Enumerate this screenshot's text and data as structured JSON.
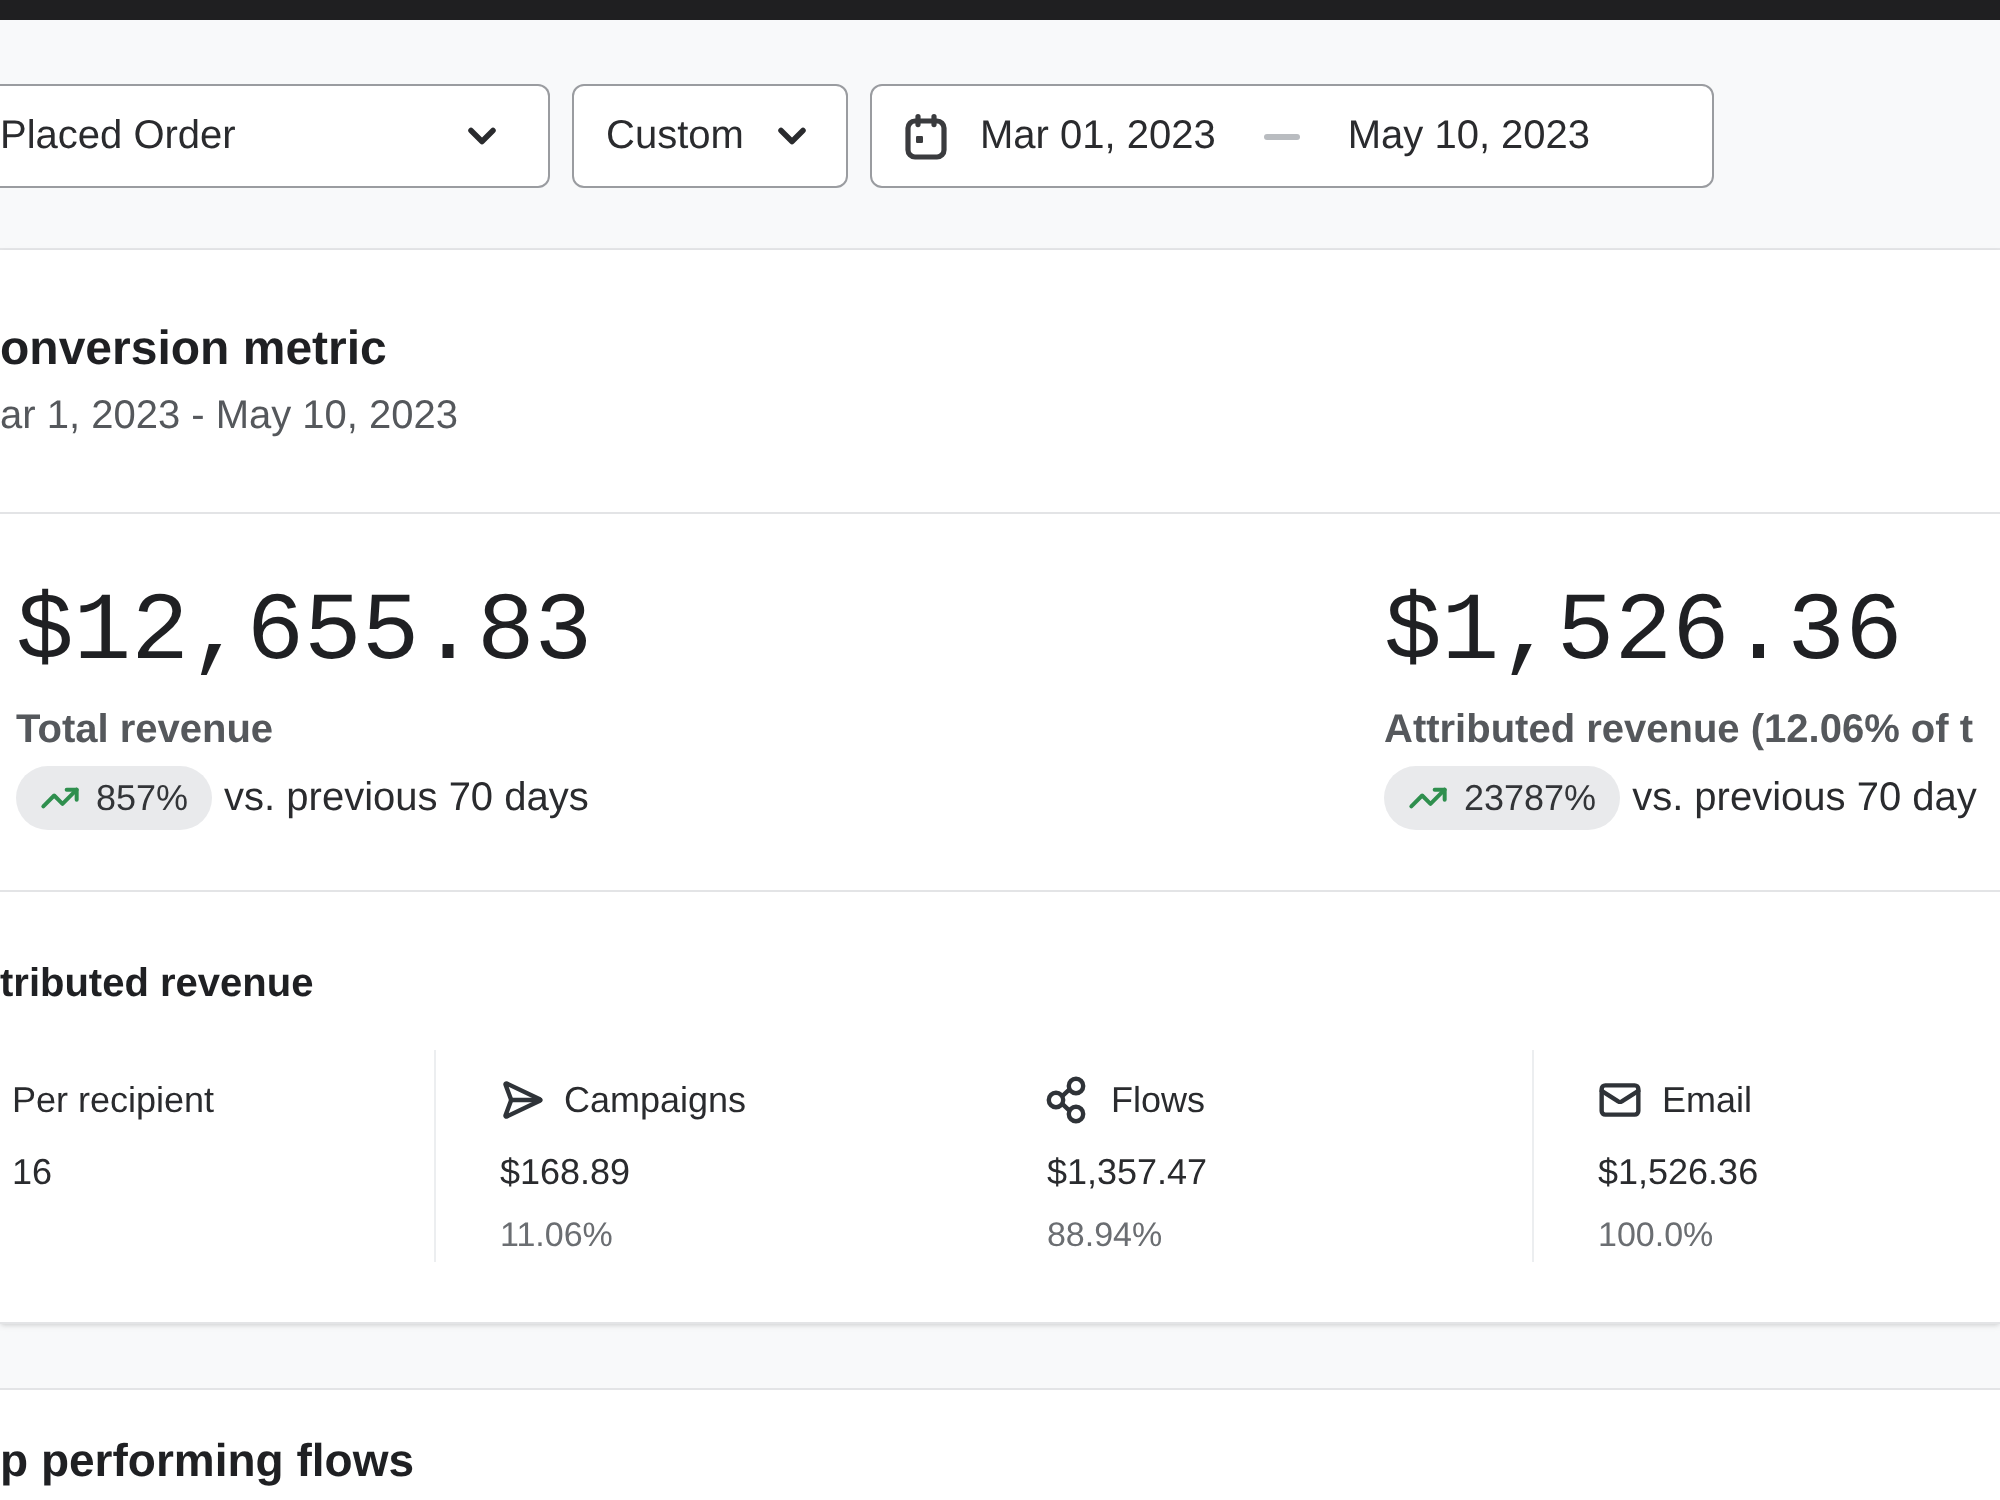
{
  "filters": {
    "metric_select": {
      "value": "Placed Order"
    },
    "range_select": {
      "value": "Custom"
    },
    "date_range": {
      "start": "Mar 01, 2023",
      "end": "May 10, 2023"
    }
  },
  "conversion_card": {
    "title": "onversion metric",
    "subtitle": "ar 1, 2023 - May 10, 2023",
    "metrics": [
      {
        "value": "$12,655.83",
        "label": "Total revenue",
        "change": "857%",
        "comparison": "vs. previous 70 days"
      },
      {
        "value": "$1,526.36",
        "label": "Attributed revenue (12.06% of t",
        "change": "23787%",
        "comparison": "vs. previous 70 day"
      }
    ],
    "attributed_revenue": {
      "title": "tributed revenue",
      "groups": [
        {
          "stats": [
            {
              "kind": "per_recipient",
              "label": "Per recipient",
              "value": "16"
            }
          ]
        },
        {
          "stats": [
            {
              "kind": "campaigns",
              "label": "Campaigns",
              "value": "$168.89",
              "share": "11.06%"
            },
            {
              "kind": "flows",
              "label": "Flows",
              "value": "$1,357.47",
              "share": "88.94%"
            }
          ]
        },
        {
          "stats": [
            {
              "kind": "email",
              "label": "Email",
              "value": "$1,526.36",
              "share": "100.0%"
            }
          ]
        }
      ]
    }
  },
  "flows_card": {
    "title": "p performing flows"
  }
}
